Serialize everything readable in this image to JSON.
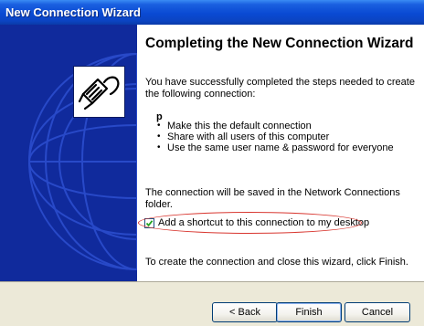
{
  "window": {
    "title": "New Connection Wizard"
  },
  "content": {
    "heading": "Completing the New Connection Wizard",
    "intro": "You have successfully completed the steps needed to create the following connection:",
    "connection_name": "p",
    "options": [
      "Make this the default connection",
      "Share with all users of this computer",
      "Use the same user name & password for everyone"
    ],
    "saved_note": "The connection will be saved in the Network Connections folder.",
    "shortcut_checkbox": {
      "label": "Add a shortcut to this connection to my desktop",
      "checked": true
    },
    "finish_note": "To create the connection and close this wizard, click Finish."
  },
  "buttons": {
    "back": "< Back",
    "finish": "Finish",
    "cancel": "Cancel"
  },
  "icons": {
    "wizard": "network-connection-icon",
    "check": "checkmark-icon"
  },
  "colors": {
    "title_bar": "#0a4ad3",
    "side_panel": "#102a9c",
    "highlight": "#d8362f",
    "button_bar": "#ece9d8"
  }
}
